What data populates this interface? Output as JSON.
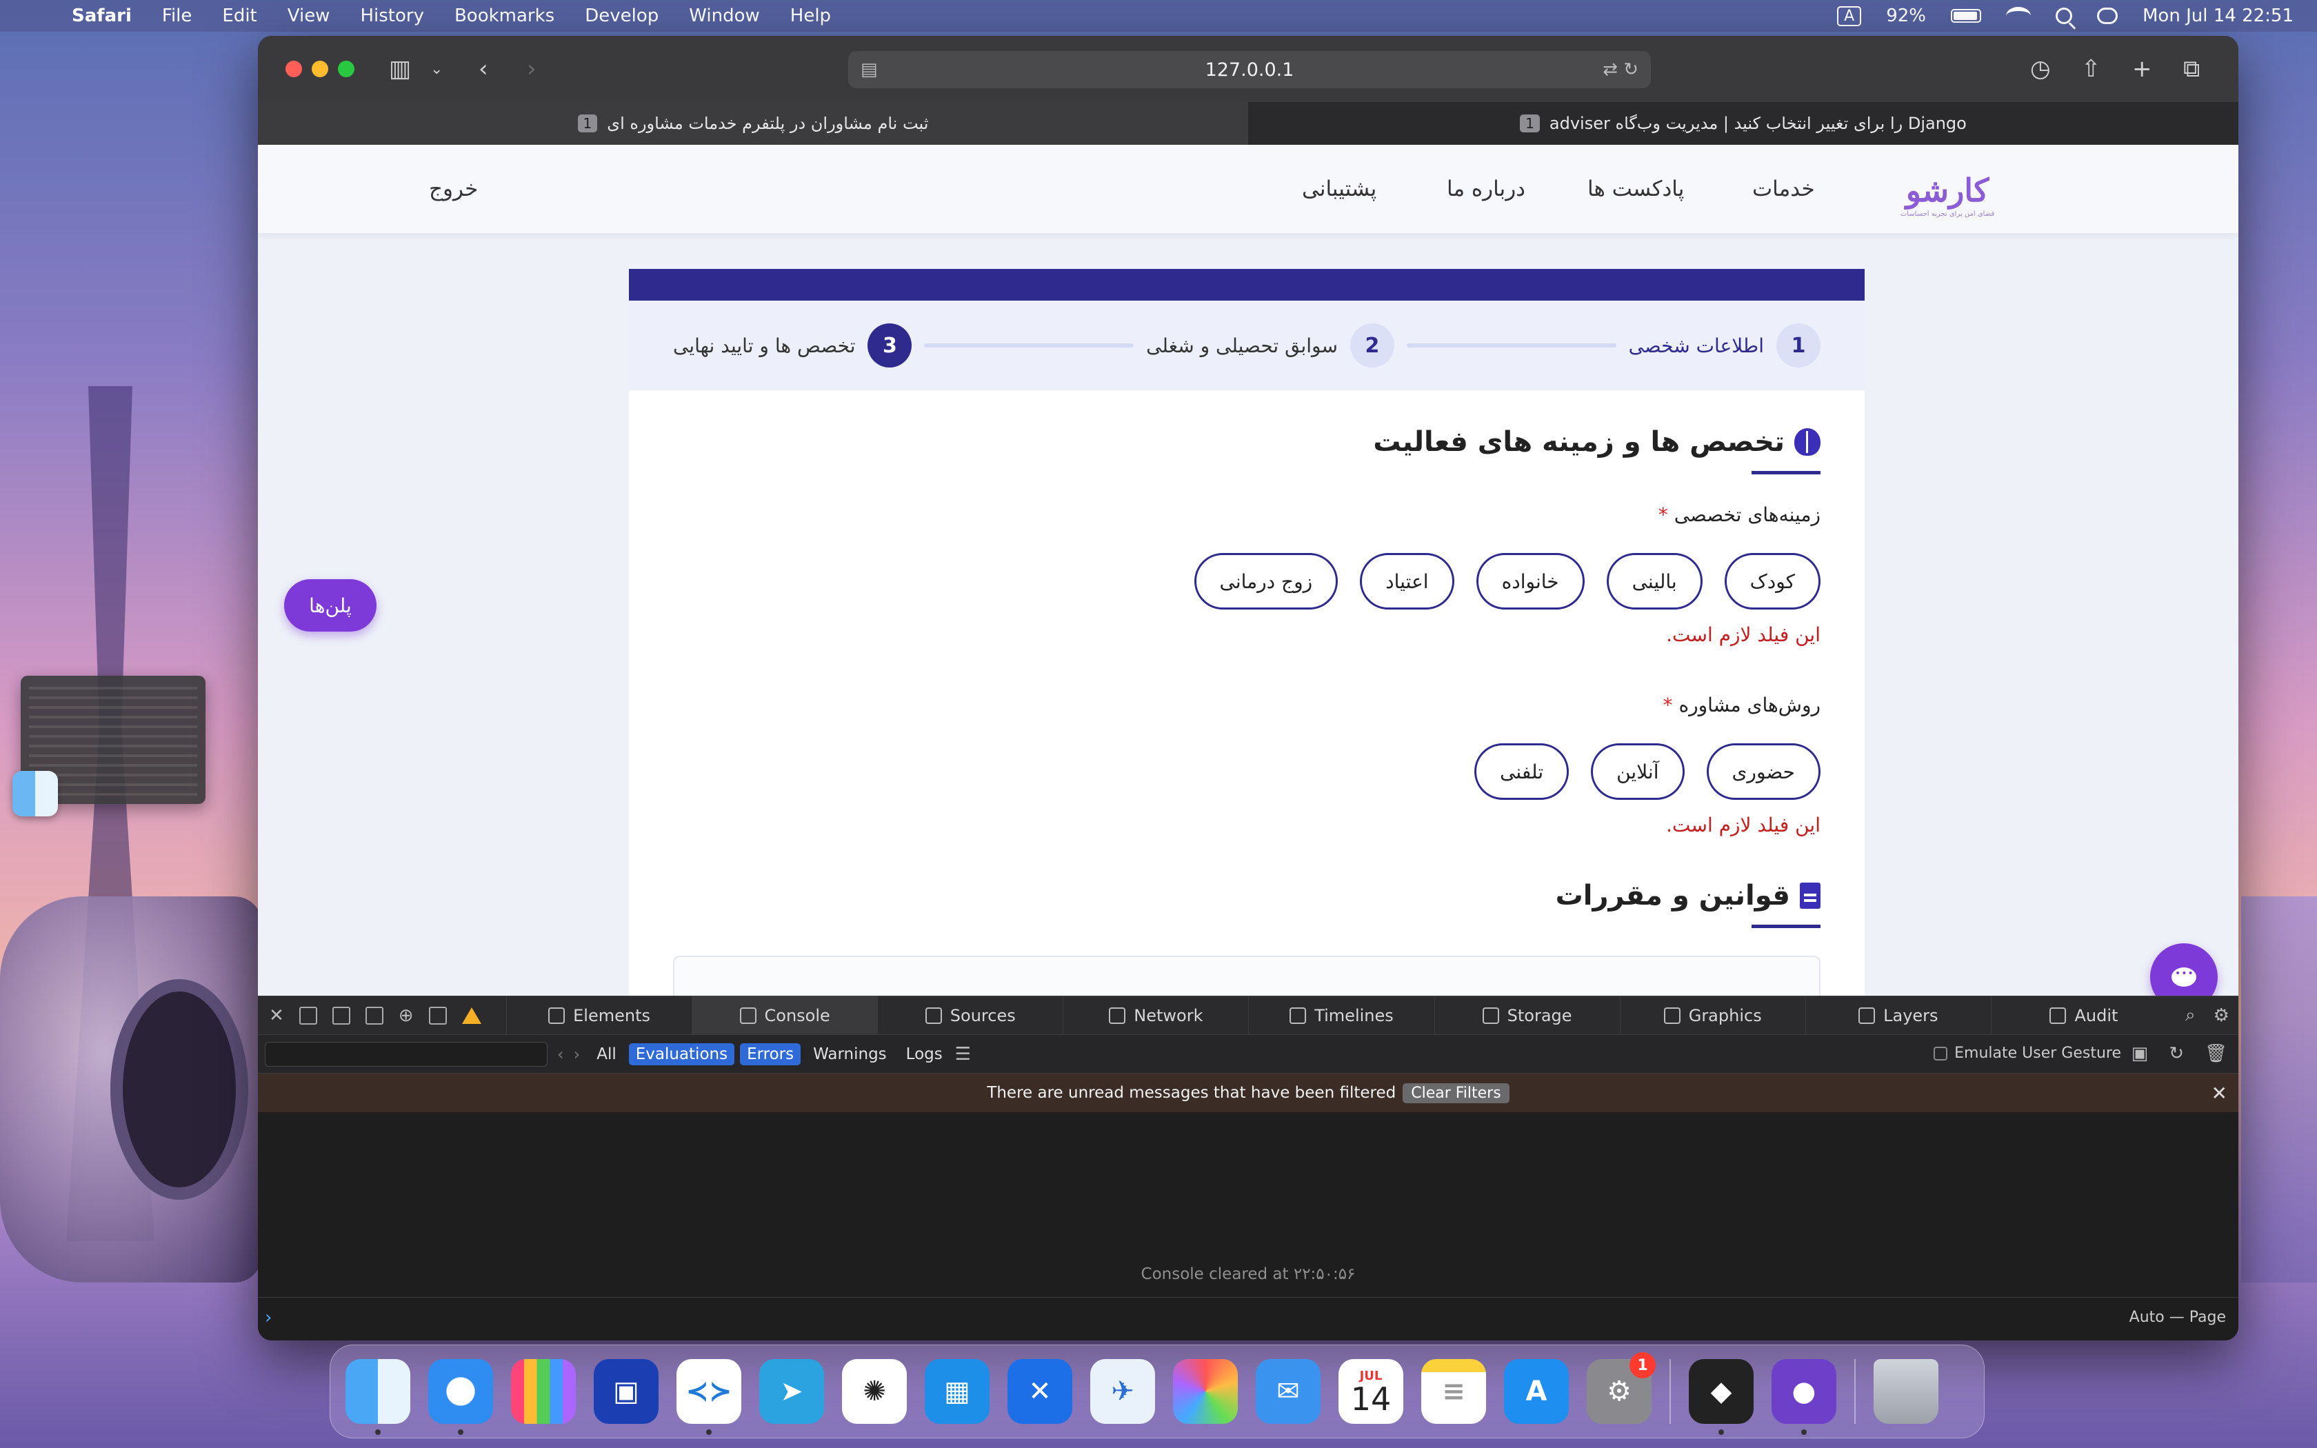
{
  "menubar": {
    "app": "Safari",
    "items": [
      "File",
      "Edit",
      "View",
      "History",
      "Bookmarks",
      "Develop",
      "Window",
      "Help"
    ],
    "keyboard": "A",
    "battery": "92%",
    "datetime": "Mon Jul 14  22:51"
  },
  "browser": {
    "url": "127.0.0.1",
    "tabs": [
      {
        "title": "ثبت نام مشاوران در پلتفرم خدمات مشاوره ای",
        "count": "1"
      },
      {
        "title": "Django را برای تغییر انتخاب کنید | مدیریت وب‌گاه adviser",
        "count": "1"
      }
    ]
  },
  "site": {
    "logo": "کارشو",
    "logo_tagline": "فضای امن برای تجربه احساسات",
    "nav": {
      "services": "خدمات",
      "podcasts": "پادکست ها",
      "about": "درباره ما",
      "support": "پشتیبانی"
    },
    "logout": "خروج",
    "plans_button": "پلن‌ها",
    "stepper": [
      {
        "num": "1",
        "label": "اطلاعات شخصی"
      },
      {
        "num": "2",
        "label": "سوابق تحصیلی و شغلی"
      },
      {
        "num": "3",
        "label": "تخصص ها و تایید نهایی"
      }
    ],
    "section_expertise": "تخصص ها و زمینه های فعالیت",
    "specialties_label": "زمینه‌های تخصصی",
    "specialties": [
      "کودک",
      "بالینی",
      "خانواده",
      "اعتیاد",
      "زوج درمانی"
    ],
    "specialties_error": "این فیلد لازم است.",
    "methods_label": "روش‌های مشاوره",
    "methods": [
      "حضوری",
      "آنلاین",
      "تلفنی"
    ],
    "methods_error": "این فیلد لازم است.",
    "required_mark": "*",
    "section_rules": "قوانین و مقررات"
  },
  "devtools": {
    "tabs": [
      "Elements",
      "Console",
      "Sources",
      "Network",
      "Timelines",
      "Storage",
      "Graphics",
      "Layers",
      "Audit"
    ],
    "filters": {
      "all": "All",
      "evaluations": "Evaluations",
      "errors": "Errors",
      "warnings": "Warnings",
      "logs": "Logs"
    },
    "emulate": "Emulate User Gesture",
    "notice": "There are unread messages that have been filtered",
    "clear_filters": "Clear Filters",
    "console_cleared": "Console cleared at ۲۲:۵۰:۵۶",
    "scope": "Auto — Page"
  },
  "dock": {
    "calendar_month": "JUL",
    "calendar_day": "14",
    "settings_badge": "1"
  }
}
